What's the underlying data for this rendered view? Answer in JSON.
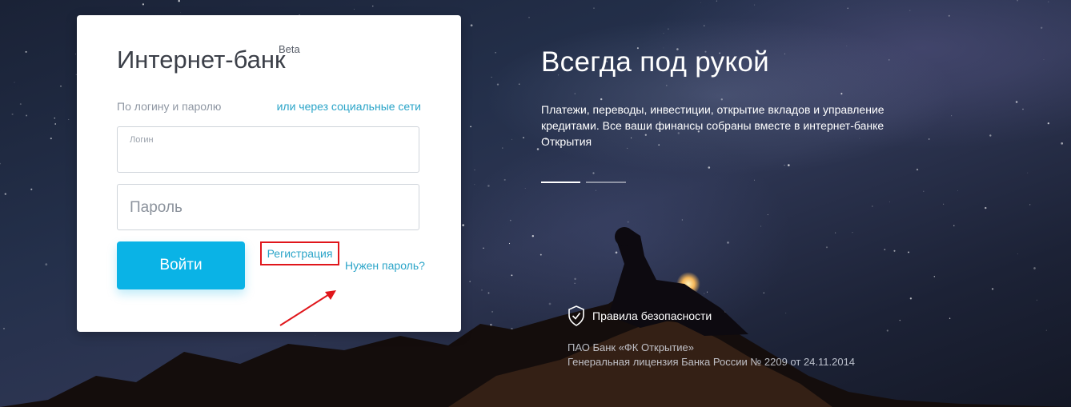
{
  "login_card": {
    "title": "Интернет-банк",
    "badge": "Beta",
    "mode_label": "По логину и паролю",
    "social_link": "или через социальные сети",
    "login_field": {
      "label": "Логин",
      "value": ""
    },
    "password_field": {
      "placeholder": "Пароль",
      "value": ""
    },
    "submit_label": "Войти",
    "register_link": "Регистрация",
    "forgot_link": "Нужен пароль?"
  },
  "hero": {
    "title": "Всегда под рукой",
    "text": "Платежи, переводы, инвестиции, открытие вкладов и управление кредитами. Все ваши финансы собраны вместе в интернет-банке Открытия",
    "slider": {
      "active_index": 0,
      "count": 2
    }
  },
  "footer": {
    "security_link": "Правила безопасности",
    "security_icon": "shield-check-icon",
    "company": "ПАО Банк «ФК Открытие»",
    "license": "Генеральная лицензия Банка России № 2209 от 24.11.2014"
  },
  "colors": {
    "accent": "#0ab3e6",
    "link": "#2aa4c8",
    "highlight": "#e0161b"
  }
}
